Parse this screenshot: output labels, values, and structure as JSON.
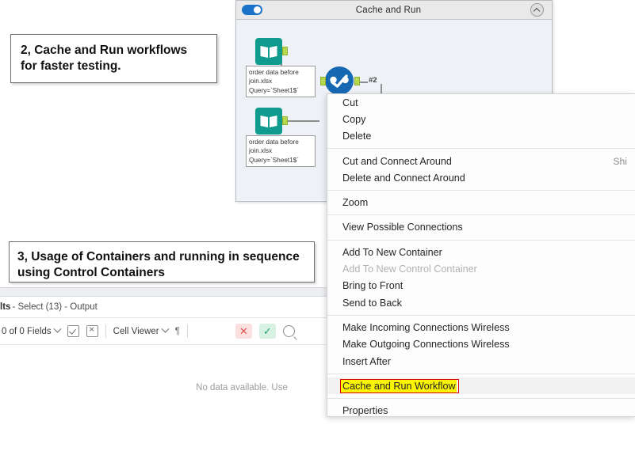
{
  "annotations": [
    {
      "id": "callout-cache",
      "text": "2, Cache and Run workflows for faster testing."
    },
    {
      "id": "callout-containers",
      "text": "3, Usage of Containers and running in sequence using Control Containers"
    }
  ],
  "workflow": {
    "container_title": "Cache and Run",
    "toggle_icon": "toggle-on-icon",
    "collapse_icon": "chevron-up-icon",
    "connection_label": "#2",
    "nodes": [
      {
        "name": "input-data-tool-1",
        "icon": "open-book-icon",
        "label": "order data before join.xlsx\nQuery=`Sheet1$`",
        "label_line1": "order data before",
        "label_line2": "join.xlsx",
        "label_line3": "Query=`Sheet1$`"
      },
      {
        "name": "input-data-tool-2",
        "icon": "open-book-icon",
        "label_line1": "order data before",
        "label_line2": "join.xlsx",
        "label_line3": "Query=`Sheet1$`"
      },
      {
        "name": "join-tool",
        "icon": "blue-circle-check-icon"
      },
      {
        "name": "select-tool",
        "icon": "purple-rect-icon"
      },
      {
        "name": "browse-tool",
        "icon": "dark-green-tool-icon",
        "selected": true,
        "highlighted": true
      },
      {
        "name": "output-tool",
        "icon": "teal-tool-icon"
      }
    ],
    "colors": {
      "input_tool": "#0f9b8e",
      "join_tool": "#1668b3",
      "select_tool": "#6b4e9e",
      "browse_tool": "#1f7a1f",
      "output_tool": "#159b8d",
      "highlight": "#fbf500",
      "anchor": "#b5d94c"
    }
  },
  "results": {
    "title_bold": "lts",
    "title_rest": " - Select (13) - Output",
    "toolbar": {
      "fields_label": "0 of 0 Fields",
      "select_all_icon": "checkbox-check-icon",
      "deselect_all_icon": "checkbox-x-icon",
      "cell_viewer_label": "Cell Viewer",
      "pilcrow_label": "¶",
      "error_icon": "x-icon",
      "ok_icon": "check-icon",
      "search_icon": "search-icon"
    },
    "empty_message": "No data available. Use"
  },
  "context_menu": {
    "items": [
      {
        "label": "Cut",
        "state": "normal"
      },
      {
        "label": "Copy",
        "state": "normal"
      },
      {
        "label": "Delete",
        "state": "normal"
      },
      {
        "separator": true
      },
      {
        "label": "Cut and Connect Around",
        "state": "normal",
        "shortcut": "Shi"
      },
      {
        "label": "Delete and Connect Around",
        "state": "normal"
      },
      {
        "separator": true
      },
      {
        "label": "Zoom",
        "state": "normal"
      },
      {
        "separator": true
      },
      {
        "label": "View Possible Connections",
        "state": "normal"
      },
      {
        "separator": true
      },
      {
        "label": "Add To New Container",
        "state": "normal"
      },
      {
        "label": "Add To New Control Container",
        "state": "disabled"
      },
      {
        "label": "Bring to Front",
        "state": "normal"
      },
      {
        "label": "Send to Back",
        "state": "normal"
      },
      {
        "separator": true
      },
      {
        "label": "Make Incoming Connections Wireless",
        "state": "normal"
      },
      {
        "label": "Make Outgoing Connections Wireless",
        "state": "normal"
      },
      {
        "label": "Insert After",
        "state": "normal"
      },
      {
        "separator": true
      },
      {
        "label": "Cache and Run Workflow",
        "state": "highlighted"
      },
      {
        "separator": true
      },
      {
        "label": "Properties",
        "state": "normal"
      }
    ],
    "highlight_color": "#fbf500",
    "outline_color": "#d40000"
  }
}
